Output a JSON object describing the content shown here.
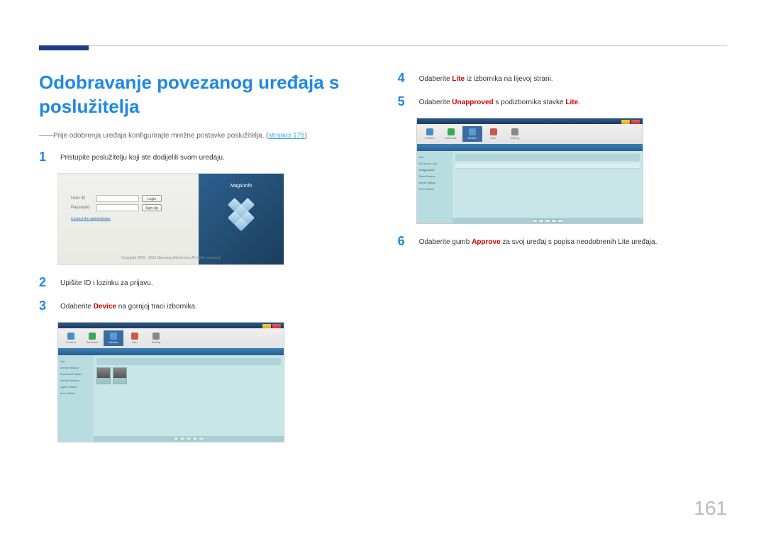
{
  "title": "Odobravanje povezanog uređaja s poslužitelja",
  "note_prefix": "――Prije odobrenja uređaja konfigurirajte mrežne postavke poslužitelja. (",
  "note_link": "stranici 175",
  "note_suffix": ")",
  "steps": {
    "s1": {
      "num": "1",
      "text": "Pristupite poslužitelju koji ste dodijelili svom uređaju."
    },
    "s2": {
      "num": "2",
      "text": "Upišite ID i lozinku za prijavu."
    },
    "s3": {
      "num": "3",
      "pre": "Odaberite ",
      "bold": "Device",
      "post": " na gornjoj traci izbornika."
    },
    "s4": {
      "num": "4",
      "pre": "Odaberite ",
      "bold": "Lite",
      "post": " iz izbornika na lijevoj strani."
    },
    "s5": {
      "num": "5",
      "pre": "Odaberite ",
      "bold": "Unapproved",
      "post": " s podizbornika stavke ",
      "bold2": "Lite",
      "post2": "."
    },
    "s6": {
      "num": "6",
      "pre": "Odaberite gumb ",
      "bold": "Approve",
      "post": " za svoj uređaj s popisa neodobrenih Lite uređaja."
    }
  },
  "login": {
    "userid": "User ID",
    "password": "Password",
    "login": "Login",
    "signup": "Sign Up",
    "contact": "Contact the administrator",
    "copyright": "Copyright 2009 - 2012 Samsung Electronics All rights reserved.",
    "logo": "MagicInfo"
  },
  "app": {
    "toolbar": [
      "Content",
      "Schedule",
      "Device",
      "User",
      "Setting"
    ],
    "sidebar1": [
      "Lite",
      "Device History",
      "Download Status",
      "Device Version",
      "Agent Status",
      "Error Status"
    ],
    "sidebar2": [
      "Lite",
      "All Device List",
      "Unapproved",
      "Data Service",
      "Agent Status",
      "Error Status"
    ]
  },
  "page_number": "161"
}
